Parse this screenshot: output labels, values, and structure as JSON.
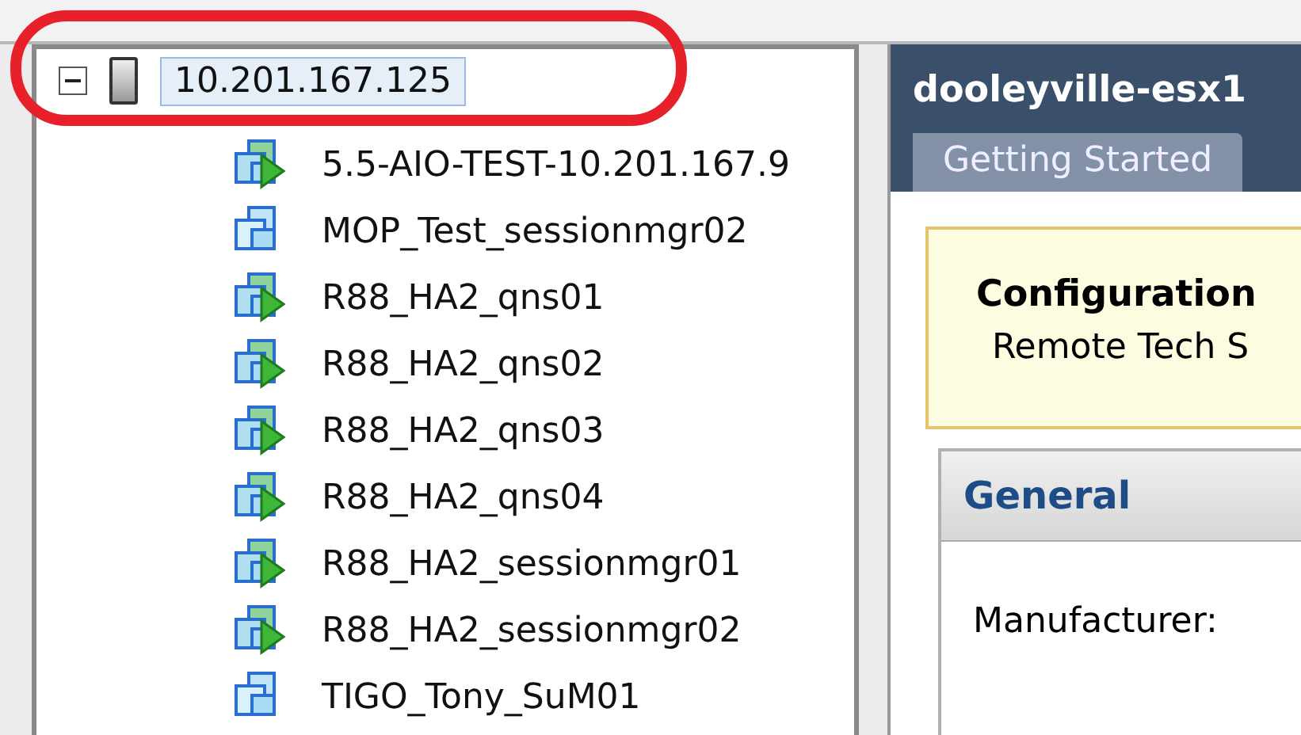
{
  "inventory_tree": {
    "root": {
      "label": "10.201.167.125",
      "expanded": true,
      "selected": true,
      "children": [
        {
          "label": "5.5-AIO-TEST-10.201.167.9",
          "powered_on": true
        },
        {
          "label": "MOP_Test_sessionmgr02",
          "powered_on": false
        },
        {
          "label": "R88_HA2_qns01",
          "powered_on": true
        },
        {
          "label": "R88_HA2_qns02",
          "powered_on": true
        },
        {
          "label": "R88_HA2_qns03",
          "powered_on": true
        },
        {
          "label": "R88_HA2_qns04",
          "powered_on": true
        },
        {
          "label": "R88_HA2_sessionmgr01",
          "powered_on": true
        },
        {
          "label": "R88_HA2_sessionmgr02",
          "powered_on": true
        },
        {
          "label": "TIGO_Tony_SuM01",
          "powered_on": false
        }
      ]
    }
  },
  "detail": {
    "title": "dooleyville-esx1",
    "tabs": [
      {
        "label": "Getting Started",
        "selected": true
      }
    ],
    "notice": {
      "heading": "Configuration",
      "text": "Remote Tech S"
    },
    "general": {
      "heading": "General",
      "fields": [
        "Manufacturer:"
      ]
    }
  }
}
